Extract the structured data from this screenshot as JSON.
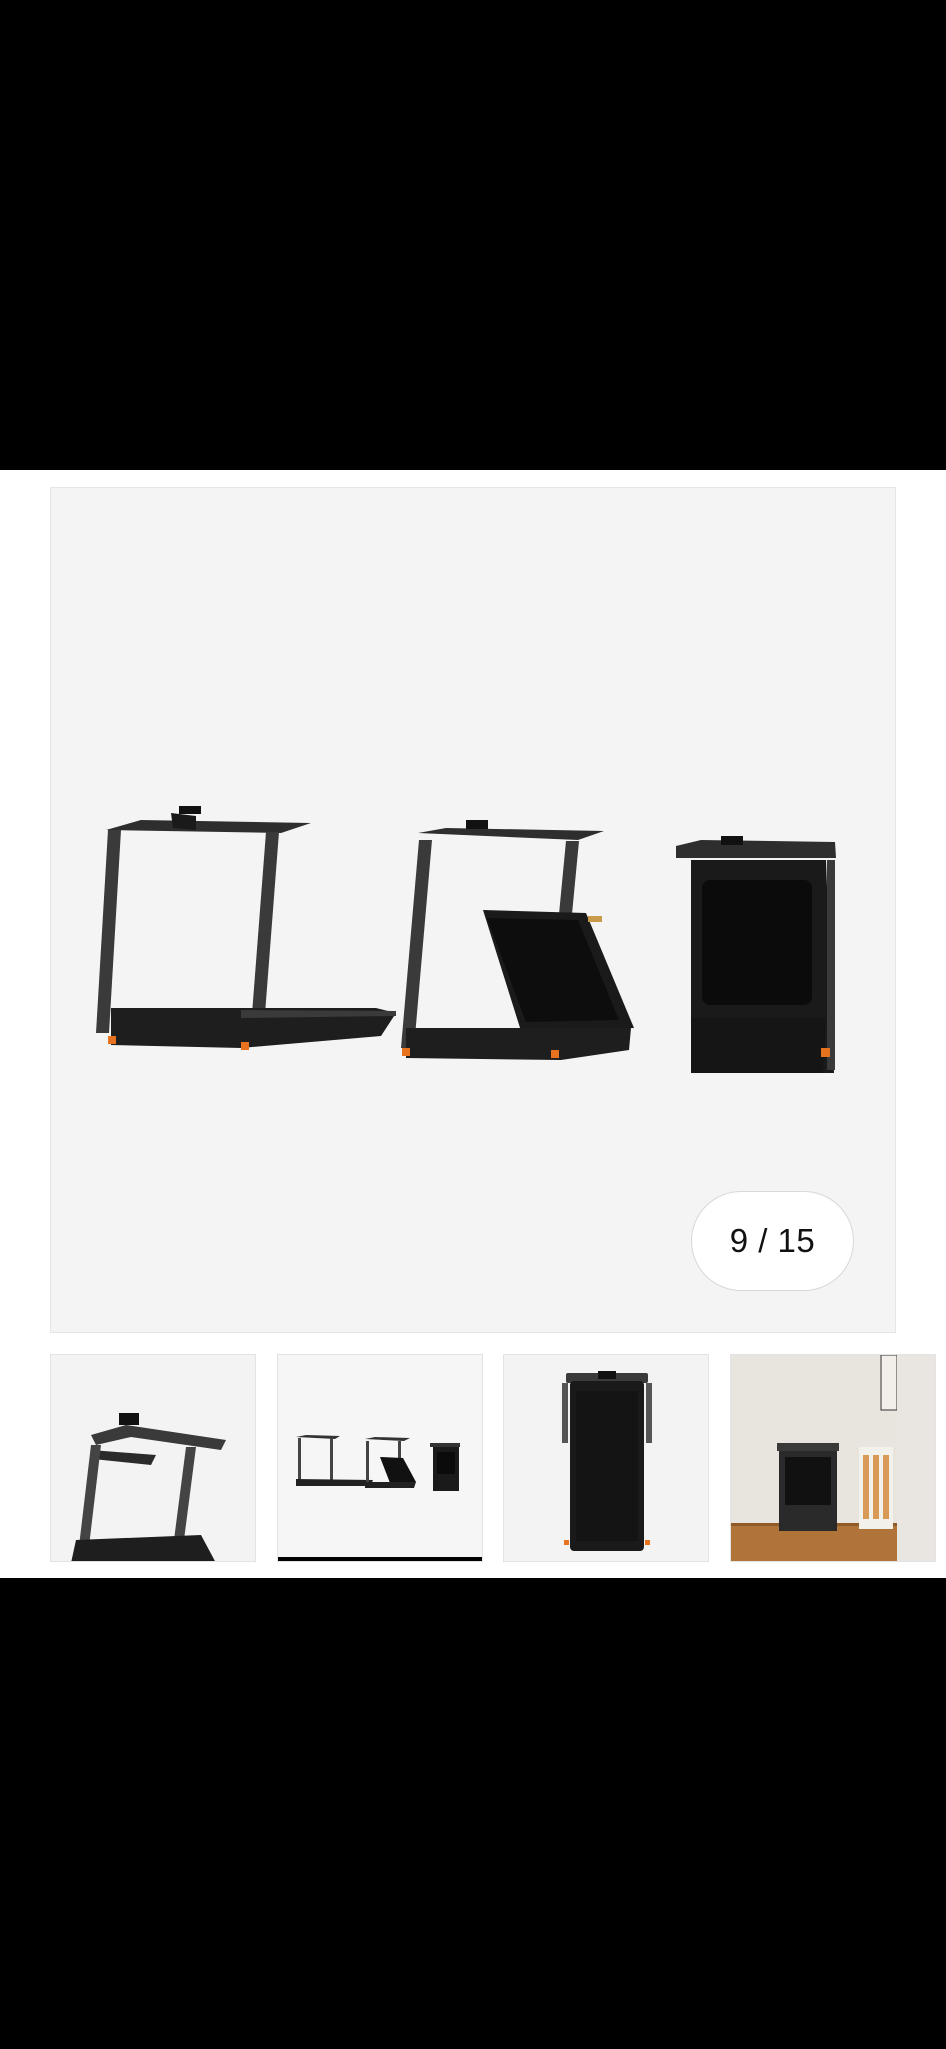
{
  "gallery": {
    "counter_text": "9 / 15",
    "current_index": 9,
    "total_count": 15,
    "main_image_icon": "treadmill-folding-sequence-image",
    "thumbnails": [
      {
        "icon": "treadmill-angle-thumbnail",
        "active": false
      },
      {
        "icon": "treadmill-folding-sequence-thumbnail",
        "active": true
      },
      {
        "icon": "treadmill-folded-top-thumbnail",
        "active": false
      },
      {
        "icon": "treadmill-in-room-thumbnail",
        "active": false
      }
    ]
  },
  "colors": {
    "frame": "#2b2b2b",
    "accent": "#e8731f",
    "image_bg": "#f4f4f4",
    "active_indicator": "#000000"
  }
}
